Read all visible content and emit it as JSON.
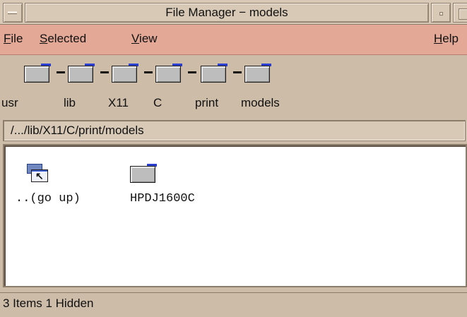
{
  "window": {
    "title": "File Manager − models"
  },
  "menubar": {
    "file": {
      "mnemonic": "F",
      "rest": "ile"
    },
    "selected": {
      "mnemonic": "S",
      "rest": "elected"
    },
    "view": {
      "mnemonic": "V",
      "rest": "iew"
    },
    "help": {
      "mnemonic": "H",
      "rest": "elp"
    }
  },
  "iconpath": {
    "folders": [
      {
        "label": "usr",
        "icon": "folder-icon"
      },
      {
        "label": "lib",
        "icon": "folder-icon"
      },
      {
        "label": "X11",
        "icon": "folder-icon"
      },
      {
        "label": "C",
        "icon": "folder-icon"
      },
      {
        "label": "print",
        "icon": "folder-icon"
      },
      {
        "label": "models",
        "icon": "folder-icon"
      }
    ]
  },
  "path": {
    "value": "/.../lib/X11/C/print/models"
  },
  "files": [
    {
      "name": "..(go up)",
      "icon": "go-up-icon"
    },
    {
      "name": "HPDJ1600C",
      "icon": "folder-icon"
    }
  ],
  "status": {
    "text": "3 Items 1 Hidden"
  },
  "colors": {
    "menubar": "#e3a896",
    "chrome": "#cdbca8",
    "folder_tab": "#2a3fd0"
  }
}
